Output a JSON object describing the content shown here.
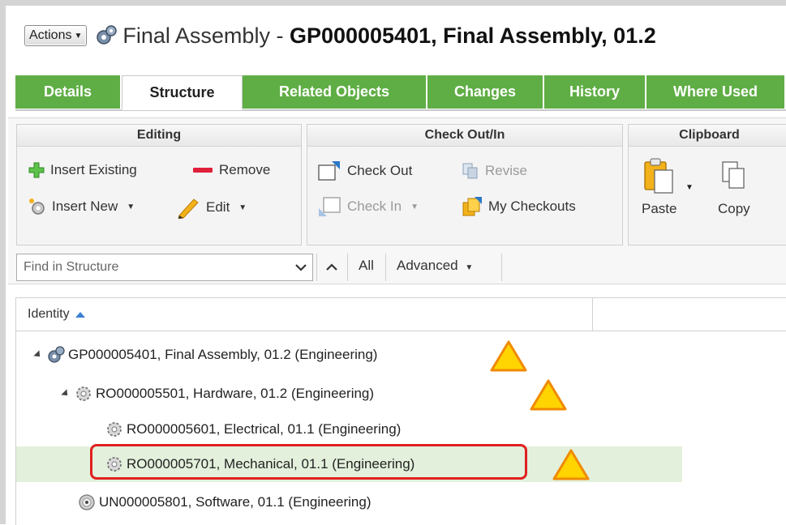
{
  "header": {
    "actions_label": "Actions",
    "object_type": "Final Assembly",
    "separator": " - ",
    "object_id": "GP000005401, Final Assembly, 01.2"
  },
  "tabs": [
    {
      "label": "Details",
      "active": false
    },
    {
      "label": "Structure",
      "active": true
    },
    {
      "label": "Related Objects",
      "active": false
    },
    {
      "label": "Changes",
      "active": false
    },
    {
      "label": "History",
      "active": false
    },
    {
      "label": "Where Used",
      "active": false
    }
  ],
  "ribbon": {
    "editing": {
      "title": "Editing",
      "insert_existing": "Insert Existing",
      "remove": "Remove",
      "insert_new": "Insert New",
      "edit": "Edit"
    },
    "checkout": {
      "title": "Check Out/In",
      "check_out": "Check Out",
      "revise": "Revise",
      "check_in": "Check In",
      "my_checkouts": "My Checkouts"
    },
    "clipboard": {
      "title": "Clipboard",
      "paste": "Paste",
      "copy": "Copy"
    }
  },
  "search": {
    "placeholder": "Find in Structure",
    "all_label": "All",
    "advanced_label": "Advanced"
  },
  "grid": {
    "column_identity": "Identity",
    "rows": [
      {
        "label": "GP000005401, Final Assembly, 01.2 (Engineering)",
        "icon": "assembly-gears-icon",
        "expanded": true,
        "warning": true
      },
      {
        "label": "RO000005501, Hardware, 01.2 (Engineering)",
        "icon": "gear-icon",
        "expanded": true,
        "warning": true
      },
      {
        "label": "RO000005601, Electrical, 01.1 (Engineering)",
        "icon": "gear-icon",
        "expanded": false,
        "warning": false
      },
      {
        "label": "RO000005701, Mechanical, 01.1 (Engineering)",
        "icon": "gear-icon",
        "expanded": false,
        "warning": true,
        "selected": true
      },
      {
        "label": "UN000005801, Software, 01.1 (Engineering)",
        "icon": "disc-icon",
        "expanded": false,
        "warning": false
      }
    ]
  },
  "colors": {
    "tab_green": "#5fae45",
    "selected_row": "#e3f0dc",
    "highlight_red": "#e02020",
    "warning_fill": "#ffd400",
    "warning_stroke": "#f08a00"
  }
}
